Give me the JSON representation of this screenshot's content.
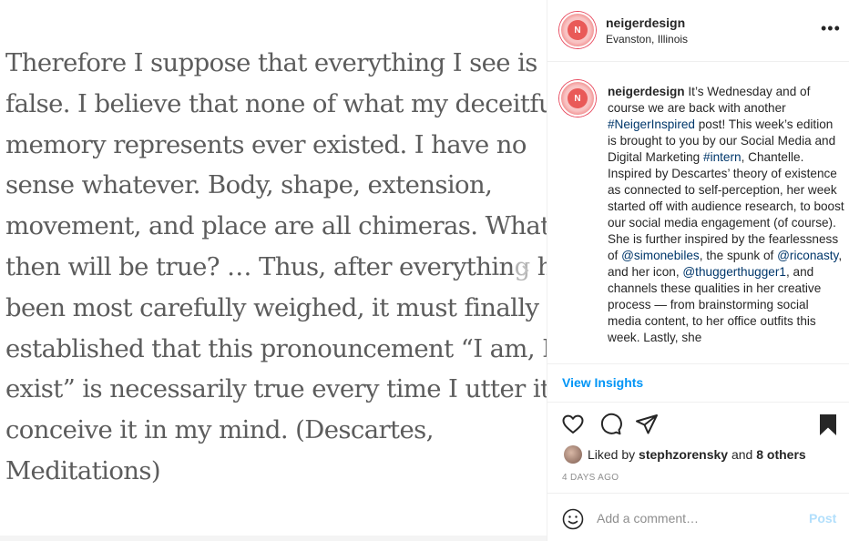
{
  "media": {
    "quote_lines": [
      "Therefore I suppose that everything I see is",
      "false. I believe that none of what my deceitful",
      "memory represents ever existed. I have no",
      "sense whatever. Body, shape, extension,",
      "movement, and place are all chimeras. What",
      "then will be true? … Thus, after everything has",
      "been most carefully weighed, it must finally be",
      "established that this pronouncement “I am, I",
      "exist” is necessarily true every time I utter it or",
      "conceive it in my mind. (Descartes,",
      "Meditations)"
    ],
    "next_icon": "chevron-right-icon"
  },
  "header": {
    "username": "neigerdesign",
    "location": "Evanston, Illinois",
    "avatar_letter": "N",
    "more_label": "•••"
  },
  "caption": {
    "username": "neigerdesign",
    "t1": " It’s Wednesday and of course we are back with another ",
    "tag1": "#NeigerInspired",
    "t2": " post! This week’s edition is brought to you by our Social Media and Digital Marketing ",
    "tag2": "#intern",
    "t3": ", Chantelle. Inspired by Descartes’ theory of existence as connected to self-perception, her week started off with audience research, to boost our social media engagement (of course). She is further inspired by the fearlessness of ",
    "tag3": "@simonebiles",
    "t4": ", the spunk of ",
    "tag4": "@riconasty",
    "t5": ", and her icon, ",
    "tag5": "@thuggerthugger1",
    "t6": ", and channels these qualities in her creative process — from brainstorming social media content, to her office outfits this week. Lastly, she"
  },
  "insights_label": "View Insights",
  "actions": {
    "like_icon": "heart-icon",
    "comment_icon": "comment-icon",
    "share_icon": "paper-plane-icon",
    "save_icon": "bookmark-icon"
  },
  "likes": {
    "prefix": "Liked by ",
    "user": "stephzorensky",
    "mid": " and ",
    "others": "8 others"
  },
  "age": "4 DAYS AGO",
  "comment_box": {
    "placeholder": "Add a comment…",
    "post_label": "Post"
  },
  "colors": {
    "link": "#00376b",
    "accent": "#0095f6",
    "post_disabled": "#b2dffc"
  }
}
